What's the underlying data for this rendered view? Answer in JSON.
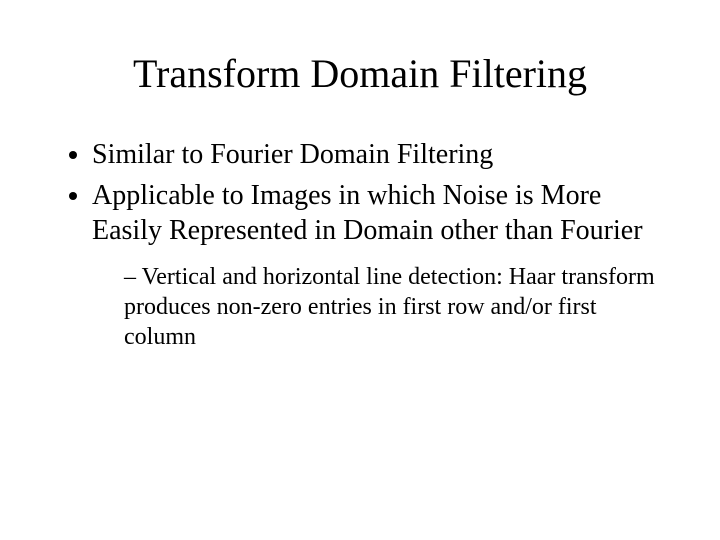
{
  "slide": {
    "title": "Transform Domain Filtering",
    "bullets": [
      "Similar to Fourier Domain Filtering",
      "Applicable to Images in which Noise is More Easily Represented in Domain other than Fourier"
    ],
    "subbullets": [
      "Vertical and horizontal line detection:  Haar transform produces non-zero entries in first row and/or first column"
    ]
  }
}
